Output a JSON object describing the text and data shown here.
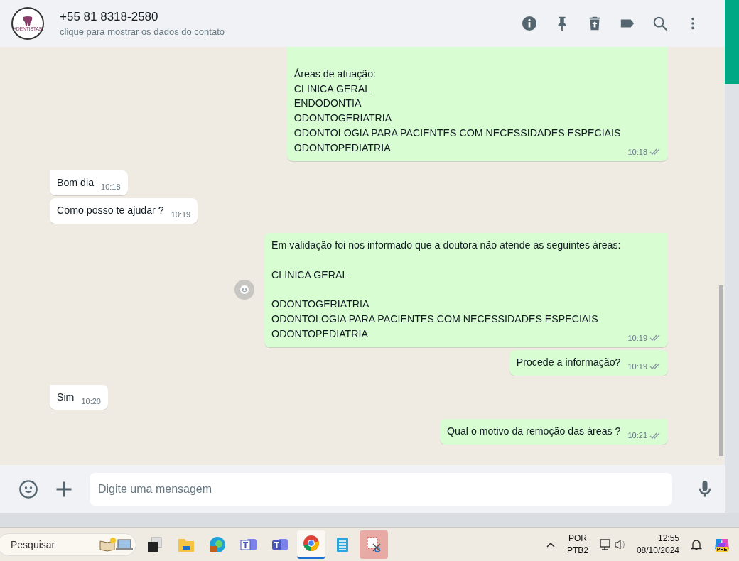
{
  "header": {
    "contact_name": "+55 81 8318-2580",
    "subtitle": "clique para mostrar os dados do contato",
    "avatar_text": "+DENTISTAS"
  },
  "messages": [
    {
      "kind": "out",
      "text": "\nÁreas de atuação:\nCLINICA GERAL\nENDODONTIA\nODONTOGERIATRIA\nODONTOLOGIA PARA PACIENTES COM NECESSIDADES ESPECIAIS\nODONTOPEDIATRIA",
      "time": "10:18",
      "read": false,
      "clipped": true
    },
    {
      "kind": "in",
      "text": "Bom dia",
      "time": "10:18",
      "tail": true
    },
    {
      "kind": "in",
      "text": "Como posso te ajudar ?",
      "time": "10:19",
      "tail": false
    },
    {
      "kind": "out",
      "text": "Em validação foi nos informado que a doutora não atende as seguintes áreas:\n\nCLINICA GERAL\n\nODONTOGERIATRIA\nODONTOLOGIA PARA PACIENTES COM NECESSIDADES ESPECIAIS\nODONTOPEDIATRIA",
      "time": "10:19",
      "read": false,
      "tail": true,
      "react_button": true
    },
    {
      "kind": "out",
      "text": "Procede a informação?",
      "time": "10:19",
      "read": false,
      "tail": false
    },
    {
      "kind": "in",
      "text": "Sim",
      "time": "10:20",
      "tail": true
    },
    {
      "kind": "out",
      "text": "Qual o motivo da remoção das áreas ?",
      "time": "10:21",
      "read": false,
      "tail": true
    }
  ],
  "composer": {
    "placeholder": "Digite uma mensagem"
  },
  "taskbar": {
    "search_placeholder": "Pesquisar",
    "apps": [
      {
        "kind": "taskview",
        "selected": false
      },
      {
        "kind": "folder",
        "selected": false
      },
      {
        "kind": "edge",
        "selected": false
      },
      {
        "kind": "teams-edu",
        "selected": false
      },
      {
        "kind": "teams",
        "selected": false
      },
      {
        "kind": "chrome",
        "selected": true
      },
      {
        "kind": "notepad",
        "selected": false
      },
      {
        "kind": "snip",
        "selected": false
      }
    ],
    "language": "POR",
    "layout": "PTB2",
    "time": "12:55",
    "date": "08/10/2024",
    "copilot_badge": "PRE"
  }
}
